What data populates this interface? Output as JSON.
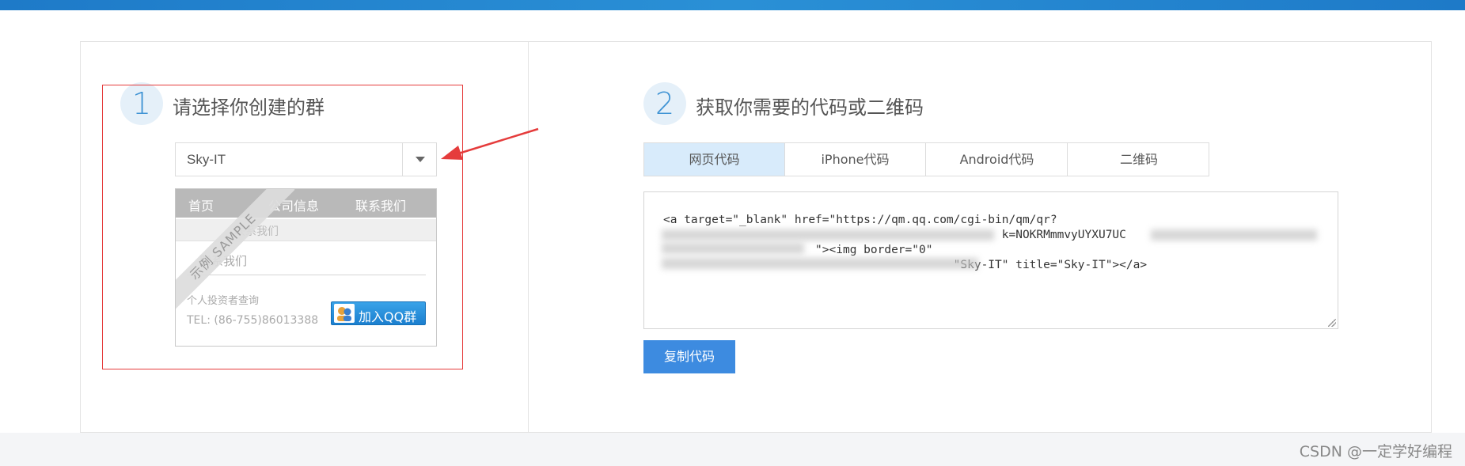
{
  "colors": {
    "accent": "#3d8be0",
    "topbar": "#1e7ac8",
    "highlight": "#e53c3c",
    "tab_active_bg": "#d8ebfb"
  },
  "step1": {
    "number": "1",
    "title": "请选择你创建的群"
  },
  "step2": {
    "number": "2",
    "title": "获取你需要的代码或二维码"
  },
  "group_select": {
    "value": "Sky-IT"
  },
  "sample": {
    "ribbon": "示例 SAMPLE",
    "nav": [
      "首页",
      "公司信息",
      "联系我们"
    ],
    "crumb": "联系我们",
    "heading": "联系我们",
    "info_label": "个人投资者查询",
    "tel": "TEL: (86-755)86013388",
    "qq_button": "加入QQ群"
  },
  "tabs": [
    {
      "label": "网页代码",
      "active": true
    },
    {
      "label": "iPhone代码",
      "active": false
    },
    {
      "label": "Android代码",
      "active": false
    },
    {
      "label": "二维码",
      "active": false
    }
  ],
  "code": {
    "line1": "<a target=\"_blank\" href=\"https://qm.qq.com/cgi-bin/qm/qr?",
    "line2": "                                                 k=NOKRMmmvyUYXU7UC",
    "line3": "                      \"><img border=\"0\"",
    "line4": "                                          \"Sky-IT\" title=\"Sky-IT\"></a>"
  },
  "copy_button": "复制代码",
  "watermark": "CSDN @一定学好编程"
}
